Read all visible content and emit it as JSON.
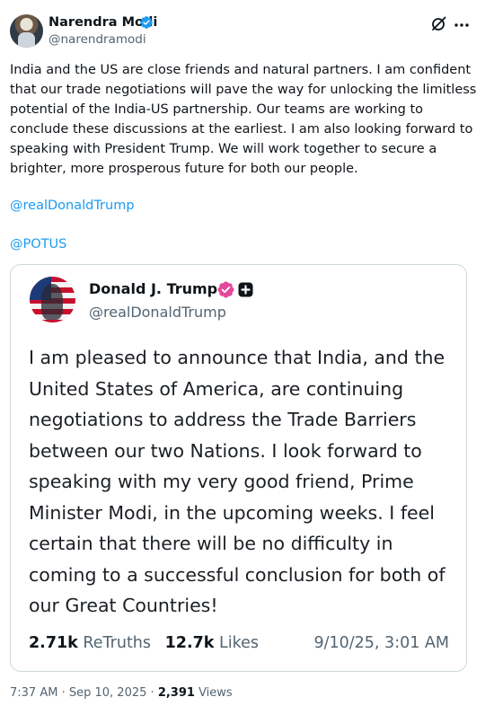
{
  "post": {
    "author": {
      "name": "Narendra Modi",
      "handle": "@narendramodi",
      "avatar": "avatar-photo",
      "verified_icon": "verified-badge-icon"
    },
    "actions": {
      "grok_icon": "grok-icon",
      "more_icon": "more-icon"
    },
    "body": {
      "text": "India and the US are close friends and natural partners. I am confident that our trade negotiations will pave the way for unlocking the limitless potential of the India-US partnership. Our teams are working to conclude these discussions at the earliest. I am also looking forward to speaking with President Trump. We will work together to secure a brighter, more prosperous future for both our people.",
      "mentions": [
        "@realDonaldTrump",
        "@POTUS"
      ]
    },
    "quote": {
      "author": {
        "name": "Donald J. Trump",
        "handle": "@realDonaldTrump",
        "avatar": "avatar-photo",
        "verified_icon": "verified-badge-icon",
        "plus_icon": "plus-badge-icon"
      },
      "text": "I am pleased to announce that India, and the United States of America, are continuing negotiations to address the Trade Barriers between our two Nations. I look forward to speaking with my very good friend, Prime Minister Modi, in the upcoming weeks. I feel certain that there will be no difficulty in coming to a successful conclusion for both of our Great Countries!",
      "retruths_count": "2.71k",
      "retruths_label": "ReTruths",
      "likes_count": "12.7k",
      "likes_label": "Likes",
      "date": "9/10/25, 3:01 AM"
    },
    "meta": {
      "time": "7:37 AM",
      "separator": "·",
      "date": "Sep 10, 2025",
      "views_count": "2,391",
      "views_label": "Views"
    },
    "colors": {
      "link": "#1d9bf0",
      "verified_blue": "#1d9bf0",
      "verified_pink": "#e5479b",
      "secondary_text": "#536471",
      "border": "#cfd9de"
    }
  }
}
